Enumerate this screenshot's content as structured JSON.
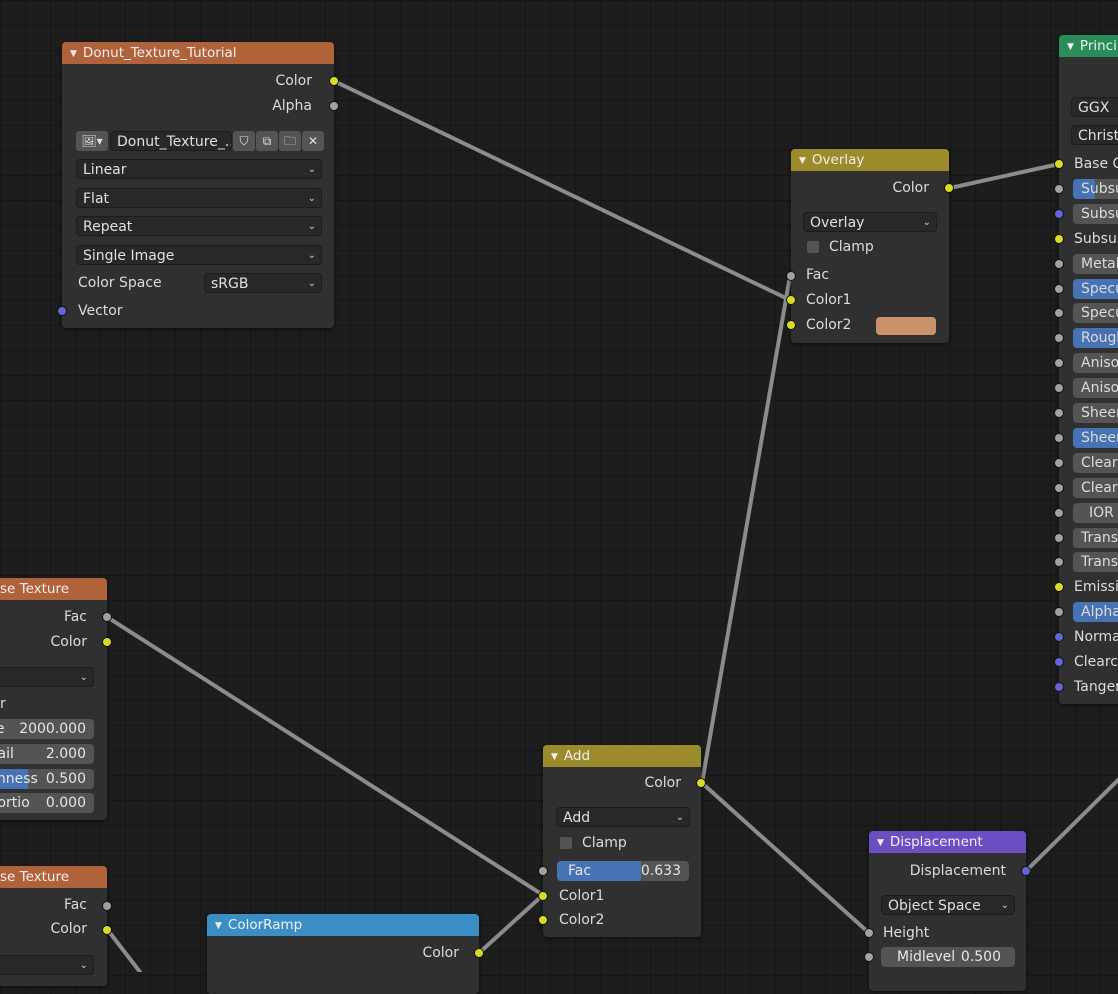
{
  "colors": {
    "input_header": "#b0623a",
    "color_header": "#9c8b2a",
    "converter_header": "#3b8ec4",
    "vector_header": "#6b4fc2",
    "shader_header": "#2a8c58",
    "socket_color": "#d9d92a",
    "socket_float": "#a1a1a1",
    "socket_vector": "#6464d6",
    "color2_swatch": "#c8936a",
    "wire": "#8c8c8c"
  },
  "image_node": {
    "title": "Donut_Texture_Tutorial",
    "out_color": "Color",
    "out_alpha": "Alpha",
    "image_name": "Donut_Texture_...",
    "interpolation": "Linear",
    "projection": "Flat",
    "extension": "Repeat",
    "source": "Single Image",
    "colorspace_label": "Color Space",
    "colorspace_value": "sRGB",
    "in_vector": "Vector",
    "icons": [
      "image-icon",
      "shield-icon",
      "duplicate-icon",
      "folder-icon",
      "close-icon"
    ]
  },
  "overlay_node": {
    "title": "Overlay",
    "out_color": "Color",
    "blend_mode": "Overlay",
    "clamp": "Clamp",
    "in_fac": "Fac",
    "in_color1": "Color1",
    "in_color2": "Color2"
  },
  "noise1": {
    "title": "se Texture",
    "out_fac": "Fac",
    "out_color": "Color",
    "r_label": "r",
    "scale_label": "le",
    "scale_value": "2000.000",
    "detail_label": "tail",
    "detail_value": "2.000",
    "rough_label": "ghness",
    "rough_value": "0.500",
    "rough_fraction": 0.5,
    "distortion_label": "tortio",
    "distortion_value": "0.000"
  },
  "noise2": {
    "title": "se Texture",
    "out_fac": "Fac",
    "out_color": "Color"
  },
  "add_node": {
    "title": "Add",
    "out_color": "Color",
    "blend_mode": "Add",
    "clamp": "Clamp",
    "fac_label": "Fac",
    "fac_value": "0.633",
    "fac_fraction": 0.633,
    "in_color1": "Color1",
    "in_color2": "Color2"
  },
  "colorramp_node": {
    "title": "ColorRamp",
    "out_color": "Color"
  },
  "displacement_node": {
    "title": "Displacement",
    "out_displacement": "Displacement",
    "space": "Object Space",
    "in_height": "Height",
    "midlevel_label": "Midlevel",
    "midlevel_value": "0.500"
  },
  "principled_node": {
    "title": "Princi",
    "distribution": "GGX",
    "subsurface_method": "Christe",
    "inputs": [
      {
        "label": "Base C",
        "socket": "yellow",
        "style": "plain"
      },
      {
        "label": "Subsu",
        "socket": "gray",
        "style": "mixed"
      },
      {
        "label": "Subsur",
        "socket": "purple",
        "style": "gray"
      },
      {
        "label": "Subsur",
        "socket": "yellow",
        "style": "plain"
      },
      {
        "label": "Metal",
        "socket": "gray",
        "style": "gray"
      },
      {
        "label": "Specu",
        "socket": "gray",
        "style": "blue"
      },
      {
        "label": "Specu",
        "socket": "gray",
        "style": "gray"
      },
      {
        "label": "Rough",
        "socket": "gray",
        "style": "blue"
      },
      {
        "label": "Aniso",
        "socket": "gray",
        "style": "gray"
      },
      {
        "label": "Aniso",
        "socket": "gray",
        "style": "gray"
      },
      {
        "label": "Sheer",
        "socket": "gray",
        "style": "gray"
      },
      {
        "label": "Sheer",
        "socket": "gray",
        "style": "blue"
      },
      {
        "label": "Clearc",
        "socket": "gray",
        "style": "gray"
      },
      {
        "label": "Clearc",
        "socket": "gray",
        "style": "gray"
      },
      {
        "label": "IOR",
        "socket": "gray",
        "style": "gray"
      },
      {
        "label": "Transr",
        "socket": "gray",
        "style": "gray"
      },
      {
        "label": "Transr",
        "socket": "gray",
        "style": "gray"
      },
      {
        "label": "Emissic",
        "socket": "yellow",
        "style": "plain"
      },
      {
        "label": "Alpha",
        "socket": "gray",
        "style": "blue"
      },
      {
        "label": "Norma",
        "socket": "purple",
        "style": "plain"
      },
      {
        "label": "Clearco",
        "socket": "purple",
        "style": "plain"
      },
      {
        "label": "Tangen",
        "socket": "purple",
        "style": "plain"
      }
    ]
  }
}
